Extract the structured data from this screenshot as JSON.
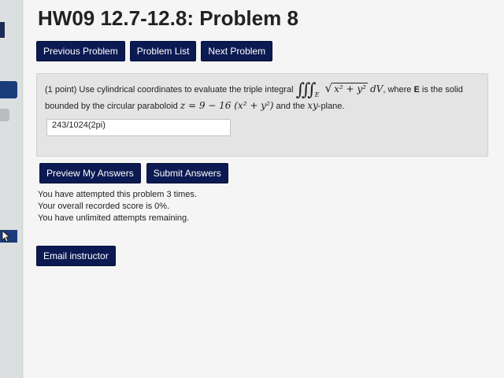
{
  "title": "HW09 12.7-12.8: Problem 8",
  "nav": {
    "previous": "Previous Problem",
    "list": "Problem List",
    "next": "Next Problem"
  },
  "problem": {
    "points": "(1 point)",
    "intro": "Use cylindrical coordinates to evaluate the triple integral",
    "integral_sign": "∭",
    "region_sub": "E",
    "radicand": "x² + y²",
    "differential": "dV",
    "where_text": ", where",
    "region_bold": "E",
    "solid_text": "is the solid",
    "line2_prefix": "bounded by the circular paraboloid",
    "paraboloid_eq": "z = 9 − 16 (x² + y²)",
    "line2_and": "and the",
    "plane_var": "xy",
    "line2_suffix": "-plane."
  },
  "answer": {
    "value": "243/1024(2pi)"
  },
  "actions": {
    "preview": "Preview My Answers",
    "submit": "Submit Answers"
  },
  "status": {
    "attempts": "You have attempted this problem 3 times.",
    "score": "Your overall recorded score is 0%.",
    "remaining": "You have unlimited attempts remaining."
  },
  "email_button": "Email instructor",
  "colors": {
    "button_bg": "#0b1a52",
    "page_bg": "#f4f5f4",
    "problem_box_bg": "#e3e4e3"
  }
}
